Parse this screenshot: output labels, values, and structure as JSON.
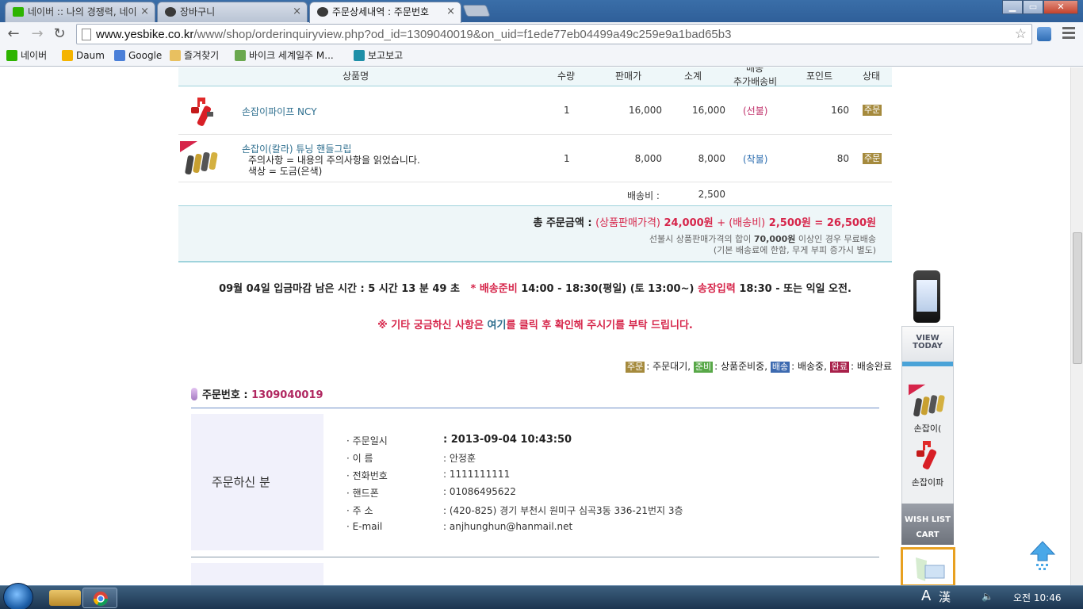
{
  "browser": {
    "tabs": [
      {
        "label": "네이버 :: 나의 경쟁력, 네이",
        "color": "#2db400"
      },
      {
        "label": "장바구니",
        "color": "#3a3a3a"
      },
      {
        "label": "주문상세내역 : 주문번호",
        "color": "#3a3a3a"
      }
    ],
    "tab_close": "×",
    "window_controls": {
      "minimize": "▁",
      "maximize": "▭",
      "close": "✕"
    },
    "nav": {
      "back": "←",
      "forward": "→",
      "reload": "↻"
    },
    "url_domain": "www.yesbike.co.kr",
    "url_path": "/www/shop/orderinquiryview.php?od_id=1309040019&on_uid=f1ede77eb04499a49c259e9a1bad65b3",
    "star": "☆",
    "bookmarks": [
      {
        "label": "네이버",
        "color": "#2db400"
      },
      {
        "label": "Daum",
        "color": "#f5b400"
      },
      {
        "label": "Google",
        "color": "#4a7fd8"
      },
      {
        "label": "즐겨찾기",
        "color": "#e8c060"
      },
      {
        "label": "바이크 세계일주 M...",
        "color": "#6aa84f"
      },
      {
        "label": "보고보고",
        "color": "#1e8fa8"
      }
    ]
  },
  "table": {
    "headers": {
      "name": "상품명",
      "qty": "수량",
      "price": "판매가",
      "subtotal": "소계",
      "ship_top": "배송",
      "ship": "추가배송비",
      "point": "포인트",
      "status": "상태"
    },
    "rows": [
      {
        "name": "손잡이파이프 NCY",
        "options": [],
        "qty": "1",
        "price": "16,000",
        "subtotal": "16,000",
        "ship": "(선불)",
        "point": "160",
        "status": "주문"
      },
      {
        "name": "손잡이(칼라) 튜닝 핸들그립",
        "options": [
          "주의사항 = 내용의 주의사항을 읽었습니다.",
          "색상 = 도금(은색)"
        ],
        "qty": "1",
        "price": "8,000",
        "subtotal": "8,000",
        "ship": "(착불)",
        "point": "80",
        "status": "주문"
      }
    ],
    "shipping_label": "배송비 :",
    "shipping_value": "2,500"
  },
  "summary": {
    "total_label": "총 주문금액 :",
    "goods_label": "(상품판매가격)",
    "goods_value": "24,000원",
    "plus": "+",
    "ship_label": "(배송비)",
    "ship_value": "2,500원",
    "eq": "=",
    "total_value": "26,500원",
    "note1_prefix": "선불시 상품판매가격의 합이 ",
    "note1_amount": "70,000원",
    "note1_suffix": " 이상인 경우 무료배송",
    "note2": "(기본 배송료에 한함, 무게 부피 증가시 별도)"
  },
  "deadline": {
    "prefix": "09월 04일 입금마감 남은 시간 : 5 시간 13 분 49 초",
    "star": "* 배송준비",
    "time1": "14:00 - 18:30(평일) (토 13:00~)",
    "invoice": "송장입력",
    "time2": "18:30 - 또는 익일 오전."
  },
  "notice": {
    "before": "※ 기타 궁금하신 사항은 ",
    "link": "여기",
    "after": "를 클릭 후 확인해 주시기를 부탁 드립니다."
  },
  "legend": [
    {
      "badge": "주문",
      "text": ": 주문대기,",
      "color": "#a58a3d"
    },
    {
      "badge": "준비",
      "text": ": 상품준비중,",
      "color": "#58a848"
    },
    {
      "badge": "배송",
      "text": ": 배송중,",
      "color": "#3d6ab0"
    },
    {
      "badge": "완료",
      "text": ": 배송완료",
      "color": "#a8204a"
    }
  ],
  "order": {
    "number_label": "주문번호 :",
    "number_value": "1309040019",
    "section_title": "주문하신 분",
    "fields": [
      {
        "k": "· 주문일시",
        "v": ": 2013-09-04 10:43:50",
        "bold": true
      },
      {
        "k": "· 이 름",
        "v": ": 안정훈",
        "bold": false
      },
      {
        "k": "· 전화번호",
        "v": ": 1111111111",
        "bold": false
      },
      {
        "k": "· 핸드폰",
        "v": ": 01086495622",
        "bold": false
      },
      {
        "k": "· 주 소",
        "v": ": (420-825) 경기 부천시 원미구 심곡3동 336-21번지 3층",
        "bold": false
      },
      {
        "k": "· E-mail",
        "v": ": anjhunghun@hanmail.net",
        "bold": false
      }
    ]
  },
  "sidebar": {
    "view_today_1": "VIEW",
    "view_today_2": "TODAY",
    "items": [
      "손잡이(",
      "손잡이파"
    ],
    "wish": "WISH LIST",
    "cart": "CART"
  },
  "taskbar": {
    "ime_a": "A",
    "ime_han": "漢",
    "time": "오전 10:46"
  }
}
